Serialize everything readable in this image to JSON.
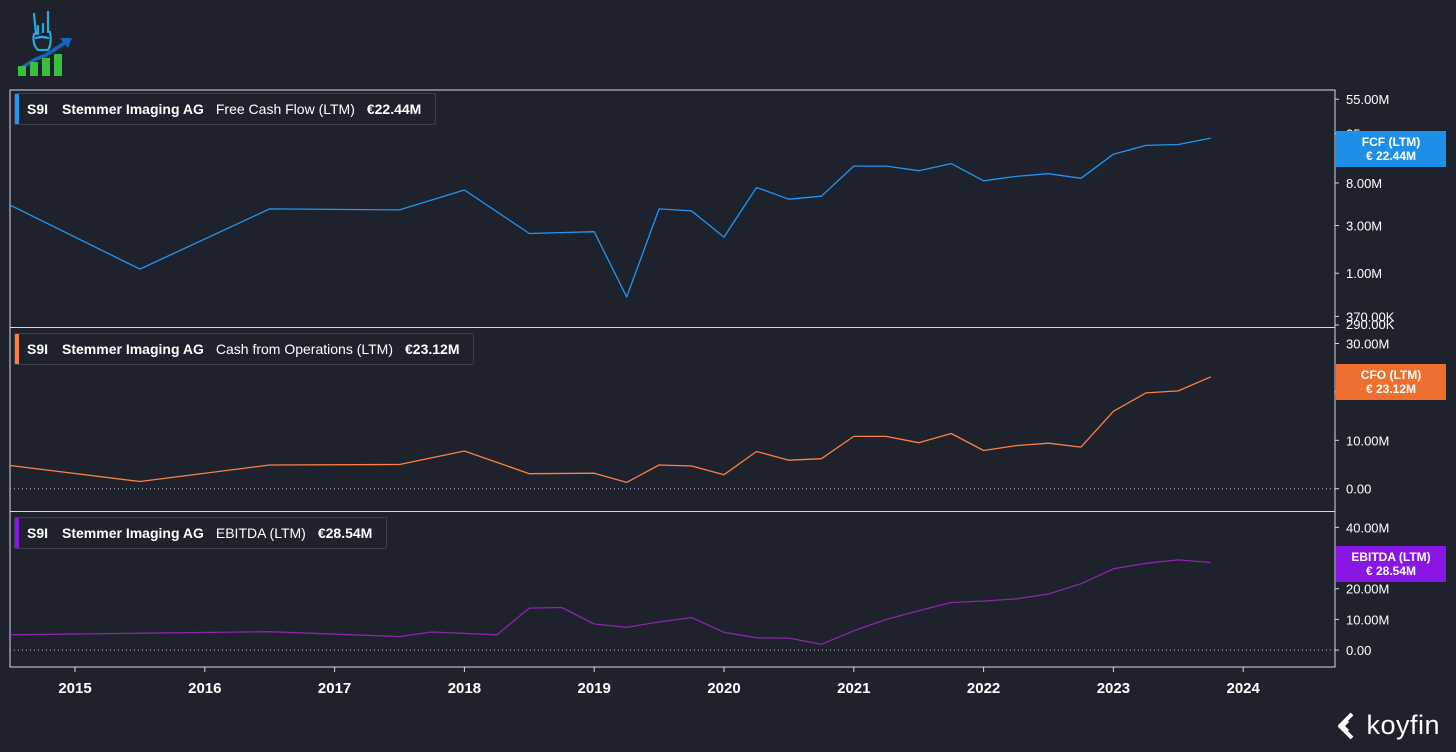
{
  "brand": {
    "name": "koyfin"
  },
  "colors": {
    "background": "#1e222d",
    "fcf": "#2196f3",
    "cfo": "#ff7f3f",
    "ebitda": "#8e24aa",
    "ebitda_badge": "#8a16e6",
    "fcf_badge": "#1e8fe8",
    "cfo_badge": "#ee6f2e"
  },
  "x_axis": {
    "labels": [
      "2015",
      "2016",
      "2017",
      "2018",
      "2019",
      "2020",
      "2021",
      "2022",
      "2023",
      "2024"
    ]
  },
  "chart_data": [
    {
      "type": "line",
      "scale": "log",
      "ticker": "S9I",
      "company": "Stemmer Imaging AG",
      "metric": "Free Cash Flow (LTM)",
      "value_label": "€22.44M",
      "badge": {
        "title": "FCF (LTM)",
        "value": "€ 22.44M"
      },
      "yticks": [
        {
          "v": 55,
          "label": "55.00M"
        },
        {
          "v": 25,
          "label": "25"
        },
        {
          "v": 8,
          "label": "8.00M"
        },
        {
          "v": 3,
          "label": "3.00M"
        },
        {
          "v": 1,
          "label": "1.00M"
        },
        {
          "v": 0.37,
          "label": "370.00K"
        }
      ],
      "ylim": [
        0.29,
        68
      ],
      "bottom_label": "290.00K",
      "x": [
        2014.5,
        2015.5,
        2016.5,
        2017.5,
        2018.0,
        2018.5,
        2019.0,
        2019.25,
        2019.5,
        2019.75,
        2020.0,
        2020.25,
        2020.5,
        2020.75,
        2021.0,
        2021.25,
        2021.5,
        2021.75,
        2022.0,
        2022.25,
        2022.5,
        2022.75,
        2023.0,
        2023.25,
        2023.5,
        2023.75
      ],
      "values": [
        4.8,
        1.1,
        4.4,
        4.3,
        6.8,
        2.5,
        2.6,
        0.58,
        4.4,
        4.2,
        2.3,
        7.2,
        5.5,
        5.9,
        11.8,
        11.8,
        10.6,
        12.5,
        8.4,
        9.3,
        9.9,
        8.9,
        15.5,
        19.0,
        19.4,
        22.44
      ]
    },
    {
      "type": "line",
      "scale": "linear",
      "ticker": "S9I",
      "company": "Stemmer Imaging AG",
      "metric": "Cash from Operations (LTM)",
      "value_label": "€23.12M",
      "badge": {
        "title": "CFO (LTM)",
        "value": "€ 23.12M"
      },
      "yticks": [
        {
          "v": 30,
          "label": "30.00M"
        },
        {
          "v": 20,
          "label": "20.00M"
        },
        {
          "v": 10,
          "label": "10.00M"
        },
        {
          "v": 0,
          "label": "0.00"
        }
      ],
      "ylim": [
        -4.6,
        33.2
      ],
      "x": [
        2014.5,
        2015.5,
        2016.5,
        2017.5,
        2018.0,
        2018.5,
        2019.0,
        2019.25,
        2019.5,
        2019.75,
        2020.0,
        2020.25,
        2020.5,
        2020.75,
        2021.0,
        2021.25,
        2021.5,
        2021.75,
        2022.0,
        2022.25,
        2022.5,
        2022.75,
        2023.0,
        2023.25,
        2023.5,
        2023.75
      ],
      "values": [
        4.8,
        1.5,
        4.9,
        5.0,
        7.8,
        3.1,
        3.2,
        1.3,
        4.9,
        4.7,
        2.9,
        7.7,
        5.9,
        6.2,
        10.8,
        10.8,
        9.5,
        11.4,
        7.9,
        8.9,
        9.4,
        8.6,
        16.0,
        19.8,
        20.2,
        23.12
      ]
    },
    {
      "type": "line",
      "scale": "linear",
      "ticker": "S9I",
      "company": "Stemmer Imaging AG",
      "metric": "EBITDA (LTM)",
      "value_label": "€28.54M",
      "badge": {
        "title": "EBITDA (LTM)",
        "value": "€ 28.54M"
      },
      "yticks": [
        {
          "v": 40,
          "label": "40.00M"
        },
        {
          "v": 20,
          "label": "20.00M"
        },
        {
          "v": 10,
          "label": "10.00M"
        },
        {
          "v": 0,
          "label": "0.00"
        }
      ],
      "ylim": [
        -5.5,
        45
      ],
      "x": [
        2014.5,
        2015.5,
        2016.5,
        2017.5,
        2017.75,
        2018.25,
        2018.5,
        2018.75,
        2019.0,
        2019.25,
        2019.5,
        2019.75,
        2020.0,
        2020.25,
        2020.5,
        2020.75,
        2021.0,
        2021.25,
        2021.5,
        2021.75,
        2022.0,
        2022.25,
        2022.5,
        2022.75,
        2023.0,
        2023.25,
        2023.5,
        2023.75
      ],
      "values": [
        5.0,
        5.5,
        6.0,
        4.4,
        5.9,
        5.0,
        13.7,
        13.9,
        8.5,
        7.4,
        9.2,
        10.6,
        5.8,
        4.0,
        3.9,
        1.9,
        6.3,
        10.0,
        12.8,
        15.5,
        16.0,
        16.7,
        18.3,
        21.6,
        26.5,
        28.3,
        29.4,
        28.54
      ]
    }
  ]
}
